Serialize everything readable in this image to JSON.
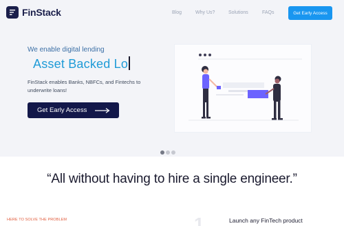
{
  "header": {
    "brand": "FinStack",
    "nav": [
      "Blog",
      "Why Us?",
      "Solutions",
      "FAQs"
    ],
    "cta": "Get Early Access"
  },
  "hero": {
    "tagline": "We enable digital lending",
    "rotating_text": "Asset Backed Lo",
    "description": "FinStack enables Banks, NBFCs, and Fintechs to underwrite loans!",
    "cta": "Get Early Access",
    "slides": {
      "count": 3,
      "active": 1
    }
  },
  "quote": "“All without having to hire a single engineer.”",
  "problem": {
    "label": "HERE TO SOLVE THE PROBLEM",
    "number": "1",
    "title": "Launch any FinTech product"
  },
  "colors": {
    "brand_navy": "#13184a",
    "accent_blue": "#1996f0",
    "rotator_blue": "#1f9bd7",
    "problem_red": "#e05a3a",
    "illustration_purple": "#6c63ff"
  }
}
